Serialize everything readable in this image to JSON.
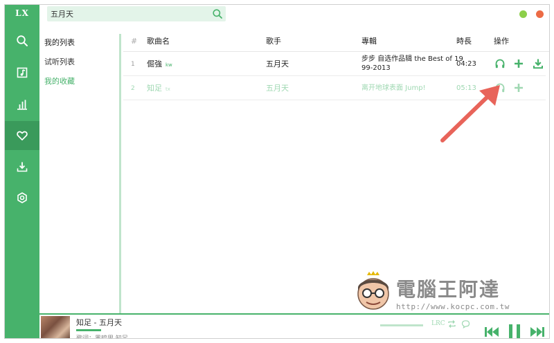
{
  "app": {
    "logo": "LX"
  },
  "search": {
    "value": "五月天",
    "placeholder": ""
  },
  "nav": [
    {
      "id": "search",
      "icon": "search-icon"
    },
    {
      "id": "songlist",
      "icon": "music-note-icon"
    },
    {
      "id": "leaderboard",
      "icon": "bar-chart-icon"
    },
    {
      "id": "favorites",
      "icon": "heart-icon",
      "active": true
    },
    {
      "id": "downloads",
      "icon": "download-icon"
    },
    {
      "id": "settings",
      "icon": "settings-icon"
    }
  ],
  "lists": {
    "header": "我的列表",
    "items": [
      {
        "label": "试听列表",
        "current": false
      },
      {
        "label": "我的收藏",
        "current": true
      }
    ]
  },
  "table": {
    "headers": {
      "index": "#",
      "name": "歌曲名",
      "singer": "歌手",
      "album": "專輯",
      "duration": "時長",
      "actions": "操作"
    },
    "rows": [
      {
        "index": "1",
        "name": "倔強",
        "quality": "kw",
        "singer": "五月天",
        "album_line1": "步步 自选作品辑 the Best of 19",
        "album_line2": "99-2013",
        "duration": "04:23"
      },
      {
        "index": "2",
        "name": "知足",
        "quality": "tx",
        "singer": "五月天",
        "album_line1": "离开地球表面 Jump!",
        "album_line2": "",
        "duration": "05:13"
      }
    ]
  },
  "watermark": {
    "title": "電腦王阿達",
    "url": "http://www.kocpc.com.tw"
  },
  "player": {
    "title": "知足 - 五月天",
    "line2": "歌词：黑暗里 知足",
    "lrc_label": "LRC",
    "progress": 0.06
  },
  "colors": {
    "accent": "#47b26b",
    "accent_dark": "#3a9a5b",
    "accent_light": "#9fd8b2",
    "arrow": "#e8645a"
  }
}
